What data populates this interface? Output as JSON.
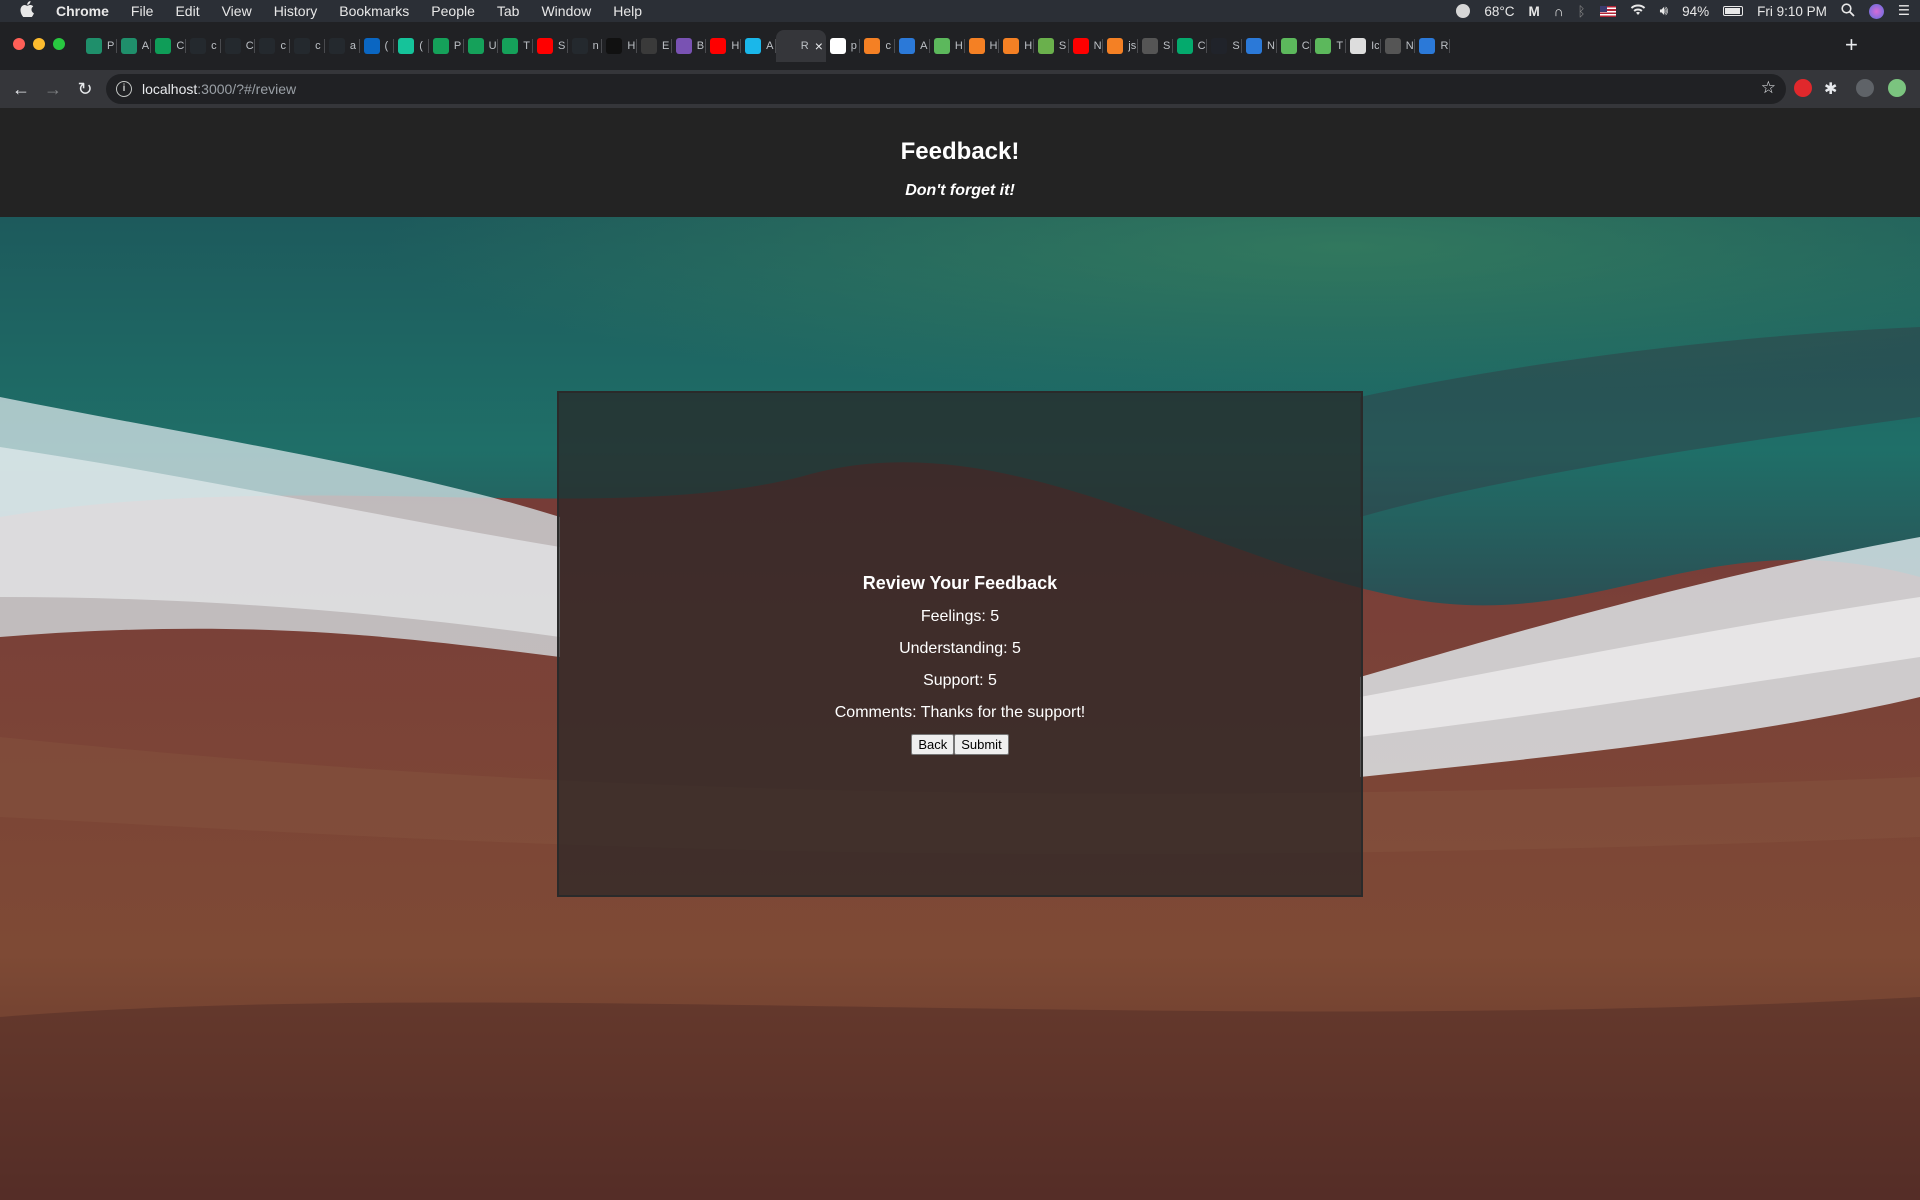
{
  "menubar": {
    "app": "Chrome",
    "items": [
      "File",
      "Edit",
      "View",
      "History",
      "Bookmarks",
      "People",
      "Tab",
      "Window",
      "Help"
    ],
    "temperature": "68°C",
    "battery": "94%",
    "clock": "Fri 9:10 PM"
  },
  "tabs": [
    {
      "label": "P",
      "icon": "sheets-icon",
      "color": "#1f8f6b"
    },
    {
      "label": "A",
      "icon": "sheets-icon",
      "color": "#1f8f6b"
    },
    {
      "label": "C",
      "icon": "sheets-icon",
      "color": "#0f9d58"
    },
    {
      "label": "c",
      "icon": "github-icon",
      "color": "#24292e"
    },
    {
      "label": "C",
      "icon": "github-icon",
      "color": "#24292e"
    },
    {
      "label": "c",
      "icon": "github-icon",
      "color": "#24292e"
    },
    {
      "label": "c",
      "icon": "github-icon",
      "color": "#24292e"
    },
    {
      "label": "a",
      "icon": "github-icon",
      "color": "#24292e"
    },
    {
      "label": "(",
      "icon": "linkedin-icon",
      "color": "#0a66c2"
    },
    {
      "label": "(",
      "icon": "grammarly-icon",
      "color": "#15c39a"
    },
    {
      "label": "P",
      "icon": "fi-icon",
      "color": "#15a15a"
    },
    {
      "label": "U",
      "icon": "fi-icon",
      "color": "#15a15a"
    },
    {
      "label": "T",
      "icon": "fi-icon",
      "color": "#15a15a"
    },
    {
      "label": "S",
      "icon": "youtube-icon",
      "color": "#ff0000"
    },
    {
      "label": "n",
      "icon": "github-icon",
      "color": "#24292e"
    },
    {
      "label": "H",
      "icon": "hand-icon",
      "color": "#111111"
    },
    {
      "label": "E",
      "icon": "mdn-icon",
      "color": "#3a3a3a"
    },
    {
      "label": "B",
      "icon": "bootstrap-icon",
      "color": "#7952b3"
    },
    {
      "label": "H",
      "icon": "youtube-icon",
      "color": "#ff0000"
    },
    {
      "label": "A",
      "icon": "vimeo-icon",
      "color": "#1ab7ea"
    },
    {
      "label": "R",
      "icon": "react-icon",
      "color": "#35363a",
      "active": true
    },
    {
      "label": "p",
      "icon": "google-icon",
      "color": "#ffffff"
    },
    {
      "label": "c",
      "icon": "stackoverflow-icon",
      "color": "#f48024"
    },
    {
      "label": "A",
      "icon": "vscode-icon",
      "color": "#2b79d8"
    },
    {
      "label": "H",
      "icon": "code-icon",
      "color": "#5cb85c"
    },
    {
      "label": "H",
      "icon": "stackoverflow-icon",
      "color": "#f48024"
    },
    {
      "label": "H",
      "icon": "stackoverflow-icon",
      "color": "#f48024"
    },
    {
      "label": "S",
      "icon": "px-icon",
      "color": "#6ab04c"
    },
    {
      "label": "N",
      "icon": "youtube-icon",
      "color": "#ff0000"
    },
    {
      "label": "js",
      "icon": "stackoverflow-icon",
      "color": "#f48024"
    },
    {
      "label": "S",
      "icon": "globe-icon",
      "color": "#555555"
    },
    {
      "label": "C",
      "icon": "w3schools-icon",
      "color": "#04aa6d"
    },
    {
      "label": "S",
      "icon": "react-icon",
      "color": "#20232a"
    },
    {
      "label": "N",
      "icon": "vscode-icon",
      "color": "#2b79d8"
    },
    {
      "label": "C",
      "icon": "code-icon",
      "color": "#5cb85c"
    },
    {
      "label": "T",
      "icon": "code-icon",
      "color": "#5cb85c"
    },
    {
      "label": "Ic",
      "icon": "page-icon",
      "color": "#dddddd"
    },
    {
      "label": "N",
      "icon": "globe-icon",
      "color": "#555555"
    },
    {
      "label": "R",
      "icon": "vscode-icon",
      "color": "#2b79d8"
    }
  ],
  "toolbar": {
    "url_host": "localhost",
    "url_rest": ":3000/?#/review"
  },
  "header": {
    "title": "Feedback!",
    "subtitle": "Don't forget it!"
  },
  "review": {
    "heading": "Review Your Feedback",
    "feelings": "Feelings: 5",
    "understanding": "Understanding: 5",
    "support": "Support: 5",
    "comments": "Comments: Thanks for the support!",
    "back_label": "Back",
    "submit_label": "Submit"
  }
}
